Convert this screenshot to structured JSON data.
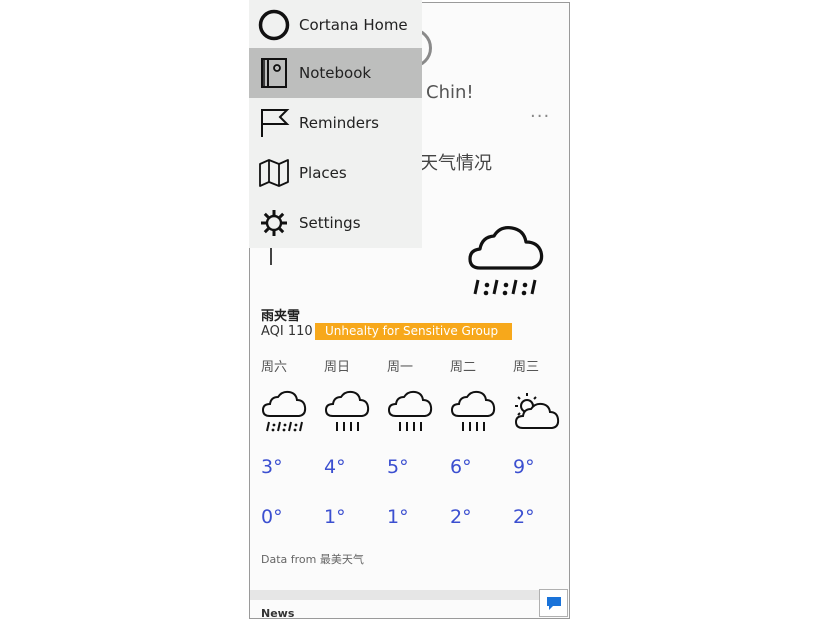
{
  "menu": {
    "items": [
      {
        "label": "Cortana Home",
        "icon": "circle-icon"
      },
      {
        "label": "Notebook",
        "icon": "notebook-icon",
        "active": true
      },
      {
        "label": "Reminders",
        "icon": "flag-icon"
      },
      {
        "label": "Places",
        "icon": "map-icon"
      },
      {
        "label": "Settings",
        "icon": "gear-icon"
      }
    ]
  },
  "card": {
    "greeting": "Chin!",
    "more": "···",
    "title": "天气情况",
    "condition": "雨夹雪",
    "aqi_text": "AQI 110",
    "aqi_badge": "Unhealty for Sensitive Group",
    "aqi_color": "#f7a81b",
    "current_icon": "sleet-icon"
  },
  "forecast": [
    {
      "day": "周六",
      "high": "3°",
      "low": "0°",
      "icon": "sleet-icon"
    },
    {
      "day": "周日",
      "high": "4°",
      "low": "1°",
      "icon": "rain-icon"
    },
    {
      "day": "周一",
      "high": "5°",
      "low": "1°",
      "icon": "rain-icon"
    },
    {
      "day": "周二",
      "high": "6°",
      "low": "2°",
      "icon": "rain-icon"
    },
    {
      "day": "周三",
      "high": "9°",
      "low": "2°",
      "icon": "partly-cloudy-icon"
    }
  ],
  "footer": {
    "source": "Data from 最美天气",
    "news": "News"
  },
  "colors": {
    "temp": "#3b4fd0",
    "menu_bg": "#f0f1f0",
    "menu_active": "#bdbebd",
    "chat_icon": "#1a73d9"
  }
}
